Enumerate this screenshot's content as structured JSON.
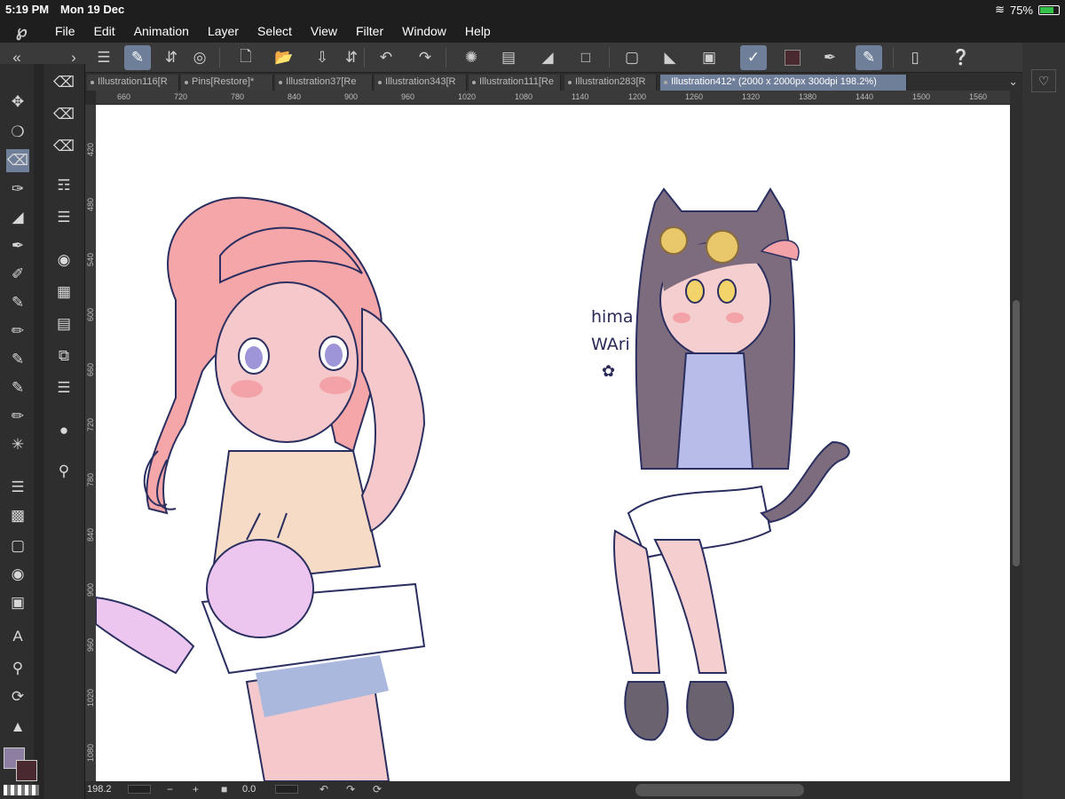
{
  "status": {
    "time": "5:19 PM",
    "date": "Mon 19 Dec",
    "battery": "75%",
    "battery_level": 0.75
  },
  "menu": {
    "items": [
      "File",
      "Edit",
      "Animation",
      "Layer",
      "Select",
      "View",
      "Filter",
      "Window",
      "Help"
    ]
  },
  "tabs": [
    {
      "label": "Illustration116[R"
    },
    {
      "label": "Pins[Restore]*"
    },
    {
      "label": "Illustration37[Re"
    },
    {
      "label": "Illustration343[R"
    },
    {
      "label": "Illustration111[Re"
    },
    {
      "label": "Illustration283[R"
    },
    {
      "label": "Illustration412* (2000 x 2000px 300dpi 198.2%)"
    }
  ],
  "ruler": {
    "top": [
      "660",
      "720",
      "780",
      "840",
      "900",
      "960",
      "1020",
      "1080",
      "1140",
      "1200",
      "1260",
      "1320",
      "1380",
      "1440",
      "1500",
      "1560"
    ],
    "left": [
      "420",
      "480",
      "540",
      "600",
      "660",
      "720",
      "780",
      "840",
      "900",
      "960",
      "1020",
      "1080"
    ]
  },
  "canvas": {
    "annotation_line1": "hima",
    "annotation_line2": "WAri"
  },
  "bottom": {
    "zoom": "198.2",
    "rotation": "0.0"
  },
  "colors": {
    "main": "#8d7fa1",
    "sub": "#4a2a30",
    "accent": "#6f7e99"
  }
}
